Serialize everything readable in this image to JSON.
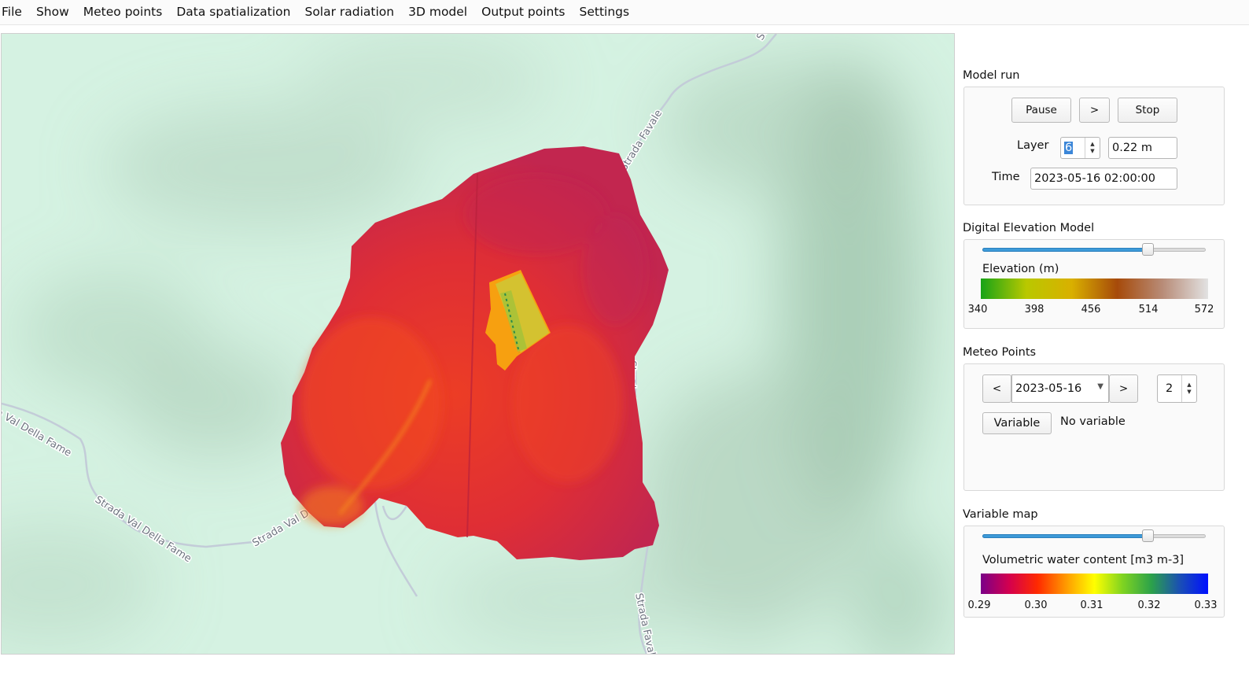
{
  "menu": [
    "File",
    "Show",
    "Meteo points",
    "Data spatialization",
    "Solar radiation",
    "3D model",
    "Output points",
    "Settings"
  ],
  "map": {
    "road_labels": [
      "St",
      "Strada Favale",
      "Strada Favale",
      "Strada Favale",
      "Strada Val Della Fame",
      "Strada Val Della Fame",
      "Strada Val Della Fame"
    ],
    "basemap_color": "#d5f2e2",
    "basin_color": "#d8302f"
  },
  "model_run": {
    "title": "Model run",
    "pause_label": "Pause",
    "next_label": ">",
    "stop_label": "Stop",
    "layer_label": "Layer",
    "layer_value": "6",
    "layer_depth": "0.22 m",
    "time_label": "Time",
    "time_value": "2023-05-16 02:00:00"
  },
  "dem": {
    "title": "Digital Elevation Model",
    "slider_level": 0.74,
    "legend_title": "Elevation (m)",
    "ticks": [
      "340",
      "398",
      "456",
      "514",
      "572"
    ],
    "colors": [
      "#17a317",
      "#b9c800",
      "#d9b000",
      "#a64a0a",
      "#b88c78",
      "#e2e2e2"
    ]
  },
  "meteo_points": {
    "title": "Meteo Points",
    "prev_label": "<",
    "date_value": "2023-05-16",
    "next_label": ">",
    "count_value": "2",
    "variable_button": "Variable",
    "variable_status": "No variable"
  },
  "variable_map": {
    "title": "Variable map",
    "slider_level": 0.74,
    "legend_title": "Volumetric water content [m3 m-3]",
    "ticks": [
      "0.29",
      "0.30",
      "0.31",
      "0.32",
      "0.33"
    ],
    "colors": [
      "#7a0088",
      "#d4004e",
      "#ff2a00",
      "#ff9a00",
      "#ffff00",
      "#7ed321",
      "#2ca24a",
      "#1a4fb4",
      "#0010ff"
    ]
  }
}
